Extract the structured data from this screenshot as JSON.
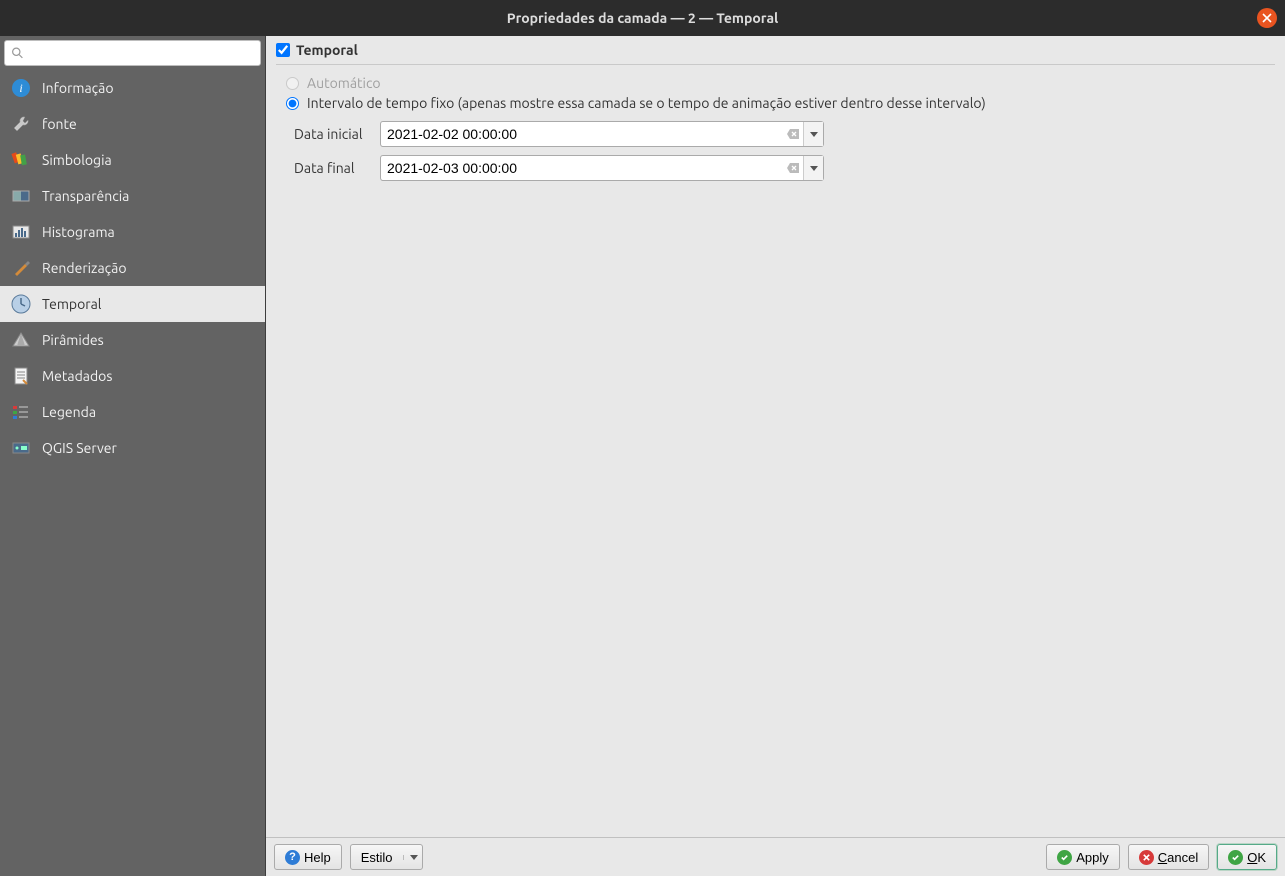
{
  "window": {
    "title": "Propriedades da camada — 2 — Temporal"
  },
  "sidebar": {
    "search_placeholder": "",
    "items": [
      {
        "id": "informacao",
        "label": "Informação",
        "active": false
      },
      {
        "id": "fonte",
        "label": "fonte",
        "active": false
      },
      {
        "id": "simbologia",
        "label": "Simbologia",
        "active": false
      },
      {
        "id": "transparencia",
        "label": "Transparência",
        "active": false
      },
      {
        "id": "histograma",
        "label": "Histograma",
        "active": false
      },
      {
        "id": "renderizacao",
        "label": "Renderização",
        "active": false
      },
      {
        "id": "temporal",
        "label": "Temporal",
        "active": true
      },
      {
        "id": "piramides",
        "label": "Pirâmides",
        "active": false
      },
      {
        "id": "metadados",
        "label": "Metadados",
        "active": false
      },
      {
        "id": "legenda",
        "label": "Legenda",
        "active": false
      },
      {
        "id": "qgis-server",
        "label": "QGIS Server",
        "active": false
      }
    ]
  },
  "panel": {
    "group_title": "Temporal",
    "group_checked": true,
    "radio_auto": {
      "label": "Automático",
      "enabled": false,
      "selected": false
    },
    "radio_fixed": {
      "label": "Intervalo de tempo fixo (apenas mostre essa camada se o tempo de animação estiver dentro desse intervalo)",
      "enabled": true,
      "selected": true
    },
    "start_label": "Data inicial",
    "start_value": "2021-02-02 00:00:00",
    "end_label": "Data final",
    "end_value": "2021-02-03 00:00:00"
  },
  "footer": {
    "help": "Help",
    "style": "Estilo",
    "apply": "Apply",
    "cancel": "Cancel",
    "ok": "OK"
  }
}
